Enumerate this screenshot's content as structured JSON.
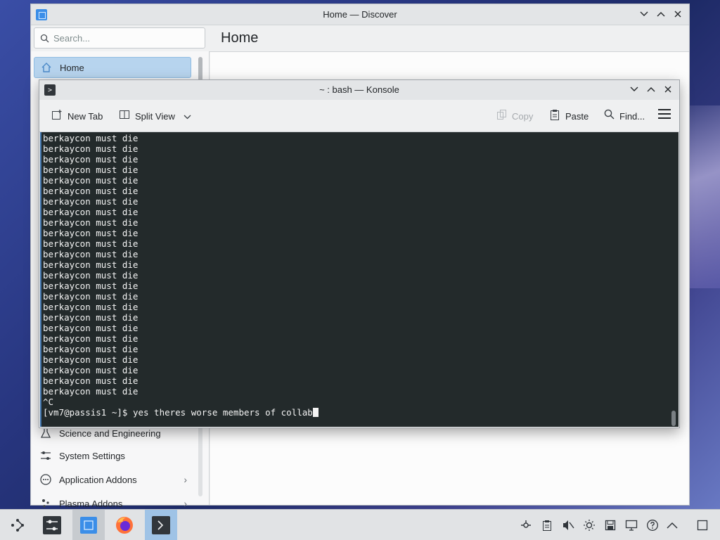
{
  "discover": {
    "title": "Home — Discover",
    "search_placeholder": "Search...",
    "header_title": "Home",
    "sidebar": {
      "items": [
        {
          "label": "Home",
          "icon": "home-icon",
          "active": true
        },
        {
          "label": "Science and Engineering",
          "icon": "science-icon"
        },
        {
          "label": "System Settings",
          "icon": "settings-sliders-icon"
        },
        {
          "label": "Application Addons",
          "icon": "addons-icon",
          "has_children": true
        },
        {
          "label": "Plasma Addons",
          "icon": "plasma-addons-icon",
          "has_children": true
        }
      ]
    }
  },
  "konsole": {
    "title": "~ : bash — Konsole",
    "toolbar": {
      "new_tab": "New Tab",
      "split_view": "Split View",
      "copy": "Copy",
      "paste": "Paste",
      "find": "Find..."
    },
    "terminal": {
      "repeated_line": "berkaycon must die",
      "repeat_count": 25,
      "interrupt": "^C",
      "prompt": "[vm7@passis1 ~]$ ",
      "command": "yes theres worse members of collab"
    }
  },
  "taskbar": {
    "items": [
      "app-launcher-icon",
      "system-settings-icon",
      "discover-icon",
      "firefox-icon",
      "konsole-icon"
    ],
    "tray": [
      "network-icon",
      "clipboard-icon",
      "volume-muted-icon",
      "brightness-icon",
      "save-icon",
      "display-icon",
      "help-icon",
      "expand-tray-icon",
      "show-desktop-icon"
    ]
  },
  "colors": {
    "terminal_bg": "#232a2b",
    "terminal_fg": "#f4f4f4",
    "accent": "#3daee9",
    "active_item": "#b7d4ee"
  }
}
